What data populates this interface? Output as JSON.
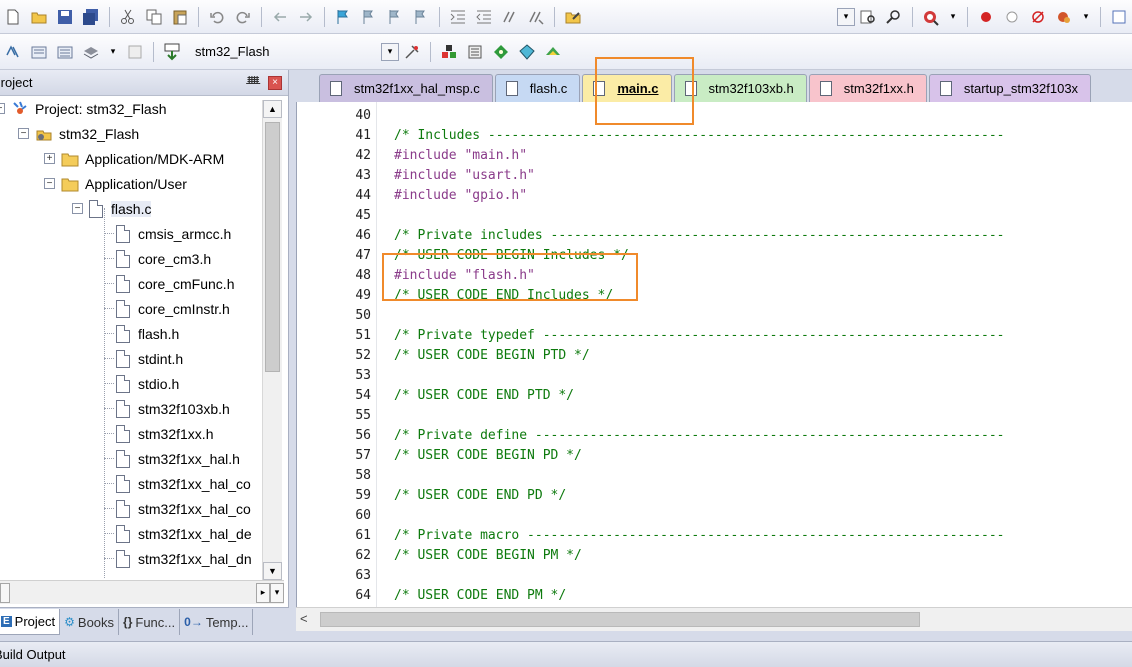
{
  "toolbar2": {
    "target": "stm32_Flash"
  },
  "project_panel": {
    "title": "Project",
    "pin_glyph": "ᚙ",
    "close_glyph": "×",
    "tree": [
      {
        "label": "Project: stm32_Flash",
        "kind": "project",
        "expander": "−"
      },
      {
        "label": "stm32_Flash",
        "kind": "target",
        "expander": "−"
      },
      {
        "label": "Application/MDK-ARM",
        "kind": "folder",
        "expander": "+"
      },
      {
        "label": "Application/User",
        "kind": "folder",
        "expander": "−"
      },
      {
        "label": "flash.c",
        "kind": "file",
        "expander": "−"
      },
      {
        "label": "cmsis_armcc.h",
        "kind": "header"
      },
      {
        "label": "core_cm3.h",
        "kind": "header"
      },
      {
        "label": "core_cmFunc.h",
        "kind": "header"
      },
      {
        "label": "core_cmInstr.h",
        "kind": "header"
      },
      {
        "label": "flash.h",
        "kind": "header"
      },
      {
        "label": "stdint.h",
        "kind": "header"
      },
      {
        "label": "stdio.h",
        "kind": "header"
      },
      {
        "label": "stm32f103xb.h",
        "kind": "header"
      },
      {
        "label": "stm32f1xx.h",
        "kind": "header"
      },
      {
        "label": "stm32f1xx_hal.h",
        "kind": "header"
      },
      {
        "label": "stm32f1xx_hal_co",
        "kind": "header"
      },
      {
        "label": "stm32f1xx_hal_co",
        "kind": "header"
      },
      {
        "label": "stm32f1xx_hal_de",
        "kind": "header"
      },
      {
        "label": "stm32f1xx_hal_dn",
        "kind": "header"
      }
    ],
    "tabs": [
      {
        "label": "Project",
        "icon": "E",
        "active": true
      },
      {
        "label": "Books",
        "icon": "⚙"
      },
      {
        "label": "Func...",
        "icon": "{}"
      },
      {
        "label": "Temp...",
        "icon": "0→"
      }
    ]
  },
  "editor": {
    "tabs": [
      {
        "label": "stm32f1xx_hal_msp.c",
        "color": "#c9bfe0"
      },
      {
        "label": "flash.c",
        "color": "#c6d9f3"
      },
      {
        "label": "main.c",
        "color": "#fbeca6",
        "active": true
      },
      {
        "label": "stm32f103xb.h",
        "color": "#c9ecc4"
      },
      {
        "label": "stm32f1xx.h",
        "color": "#f8c4cc"
      },
      {
        "label": "startup_stm32f103x",
        "color": "#d8c3ea"
      }
    ],
    "lines": [
      {
        "n": "40",
        "text": ""
      },
      {
        "n": "41",
        "text": "/* Includes ------------------------------------------------------------------",
        "type": "cmt"
      },
      {
        "n": "42",
        "text": "#include \"main.h\"",
        "type": "inc"
      },
      {
        "n": "43",
        "text": "#include \"usart.h\"",
        "type": "inc"
      },
      {
        "n": "44",
        "text": "#include \"gpio.h\"",
        "type": "inc"
      },
      {
        "n": "45",
        "text": ""
      },
      {
        "n": "46",
        "text": "/* Private includes ----------------------------------------------------------",
        "type": "cmt"
      },
      {
        "n": "47",
        "text": "/* USER CODE BEGIN Includes */",
        "type": "cmt"
      },
      {
        "n": "48",
        "text": "#include \"flash.h\"",
        "type": "inc"
      },
      {
        "n": "49",
        "text": "/* USER CODE END Includes */",
        "type": "cmt"
      },
      {
        "n": "50",
        "text": ""
      },
      {
        "n": "51",
        "text": "/* Private typedef -----------------------------------------------------------",
        "type": "cmt"
      },
      {
        "n": "52",
        "text": "/* USER CODE BEGIN PTD */",
        "type": "cmt"
      },
      {
        "n": "53",
        "text": ""
      },
      {
        "n": "54",
        "text": "/* USER CODE END PTD */",
        "type": "cmt"
      },
      {
        "n": "55",
        "text": ""
      },
      {
        "n": "56",
        "text": "/* Private define ------------------------------------------------------------",
        "type": "cmt"
      },
      {
        "n": "57",
        "text": "/* USER CODE BEGIN PD */",
        "type": "cmt"
      },
      {
        "n": "58",
        "text": ""
      },
      {
        "n": "59",
        "text": "/* USER CODE END PD */",
        "type": "cmt"
      },
      {
        "n": "60",
        "text": ""
      },
      {
        "n": "61",
        "text": "/* Private macro -------------------------------------------------------------",
        "type": "cmt"
      },
      {
        "n": "62",
        "text": "/* USER CODE BEGIN PM */",
        "type": "cmt"
      },
      {
        "n": "63",
        "text": ""
      },
      {
        "n": "64",
        "text": "/* USER CODE END PM */",
        "type": "cmt"
      }
    ]
  },
  "build_output": {
    "title": "Build Output"
  },
  "colors": {
    "highlight": "#f08a2b",
    "comment": "#0d7a0d",
    "include": "#8a3b8a"
  }
}
